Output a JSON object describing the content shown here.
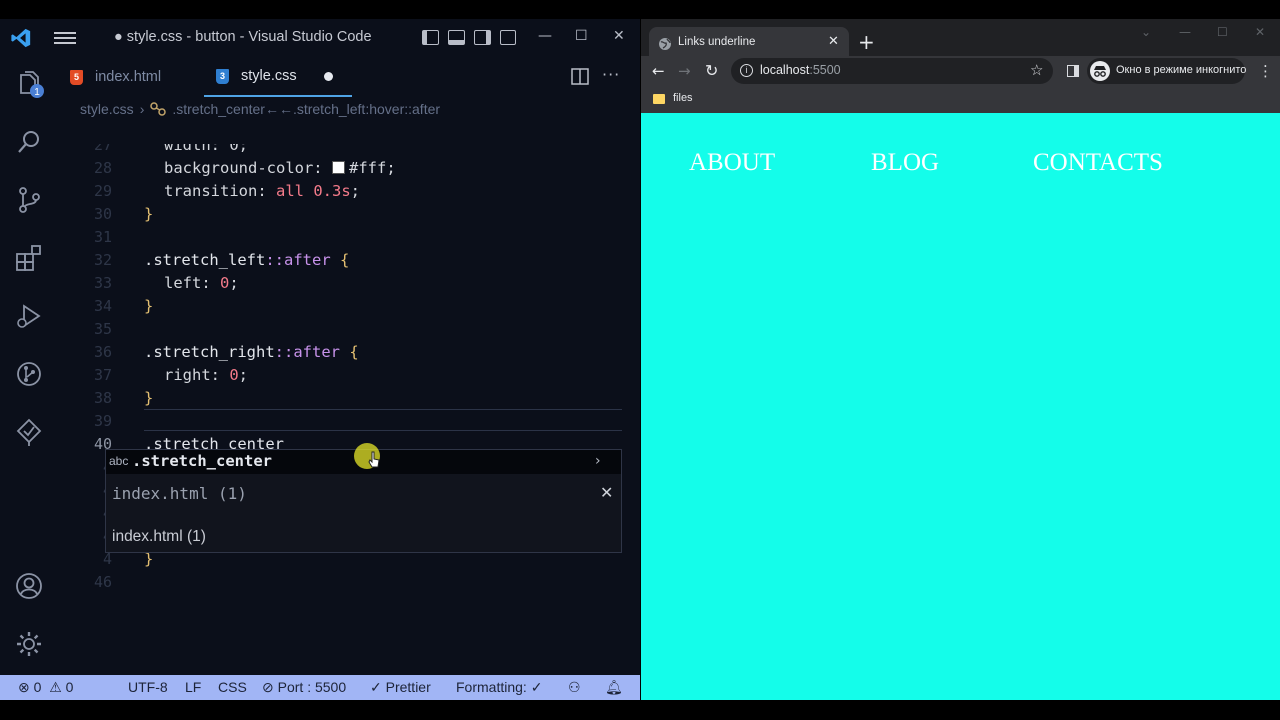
{
  "vscode": {
    "title": "style.css - button - Visual Studio Code",
    "tabs": [
      {
        "label": "index.html",
        "type": "html",
        "active": false
      },
      {
        "label": "style.css",
        "type": "css",
        "active": true,
        "unsaved": true
      }
    ],
    "breadcrumb": {
      "file": "style.css",
      "symbol": ".stretch_center←←.stretch_left:hover::after"
    },
    "explorer_badge": "1",
    "lines": [
      {
        "n": "27",
        "text": "width: 0;"
      },
      {
        "n": "28",
        "prop": "background-color: ",
        "value": "#fff",
        "end": ";"
      },
      {
        "n": "29",
        "prop": "transition: ",
        "kw": "all",
        "num": "0.3s",
        "end": ";"
      },
      {
        "n": "30",
        "brace": "}"
      },
      {
        "n": "31"
      },
      {
        "n": "32",
        "selector": ".stretch_left",
        "pseudo": "::after",
        "brace": "{"
      },
      {
        "n": "33",
        "prop": "left: ",
        "num": "0",
        "end": ";"
      },
      {
        "n": "34",
        "brace": "}"
      },
      {
        "n": "35"
      },
      {
        "n": "36",
        "selector": ".stretch_right",
        "pseudo": "::after",
        "brace": "{"
      },
      {
        "n": "37",
        "prop": "right: ",
        "num": "0",
        "end": ";"
      },
      {
        "n": "38",
        "brace": "}"
      },
      {
        "n": "39"
      },
      {
        "n": "40",
        "selector": ".stretch_center"
      },
      {
        "n": "4"
      },
      {
        "n": "4"
      },
      {
        "n": "4"
      },
      {
        "n": "4"
      },
      {
        "n": "4",
        "brace": "}"
      },
      {
        "n": "46"
      }
    ],
    "suggest": {
      "kind": "abc",
      "label": ".stretch_center",
      "detail_mono": "index.html (1)",
      "detail_text": "index.html (1)"
    },
    "status": {
      "errors": "0",
      "warnings": "0",
      "encoding": "UTF-8",
      "eol": "LF",
      "language": "CSS",
      "port": "Port : 5500",
      "prettier": "Prettier",
      "formatting": "Formatting: ✓"
    }
  },
  "browser": {
    "tab_title": "Links underline",
    "url_host": "localhost",
    "url_port": ":5500",
    "incognito": "Окно в режиме инкогнито",
    "bookmark": "files",
    "page_background": "#14fdea",
    "nav_links": [
      "ABOUT",
      "BLOG",
      "CONTACTS"
    ]
  }
}
